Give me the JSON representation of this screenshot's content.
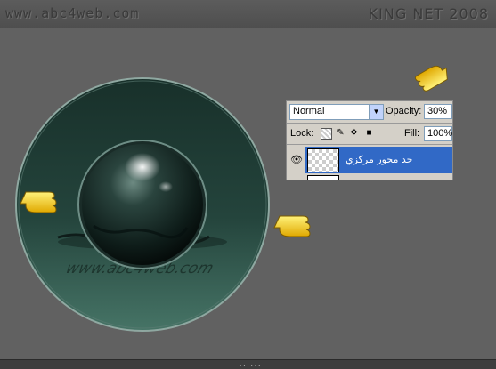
{
  "watermarks": {
    "left": "www.abc4web.com",
    "right": "KING NET 2008"
  },
  "artwork": {
    "reflection_text": "www.abc4web.com"
  },
  "layers_panel": {
    "blend_mode": "Normal",
    "opacity_label": "Opacity:",
    "opacity_value": "30%",
    "lock_label": "Lock:",
    "fill_label": "Fill:",
    "fill_value": "100%",
    "layer_name": "حد محور مركزي"
  },
  "status": {
    "grip": "......"
  },
  "colors": {
    "background": "#616161",
    "disc_dark": "#1d3530",
    "disc_light": "#3f6b60",
    "layer_selected": "#3169c6",
    "pointer_hand": "#f5d500"
  },
  "icons": [
    "hand-pointer-icon",
    "eye-icon",
    "lock-transparent-icon",
    "lock-brush-icon",
    "lock-move-icon",
    "lock-all-icon",
    "dropdown-arrow-icon"
  ]
}
